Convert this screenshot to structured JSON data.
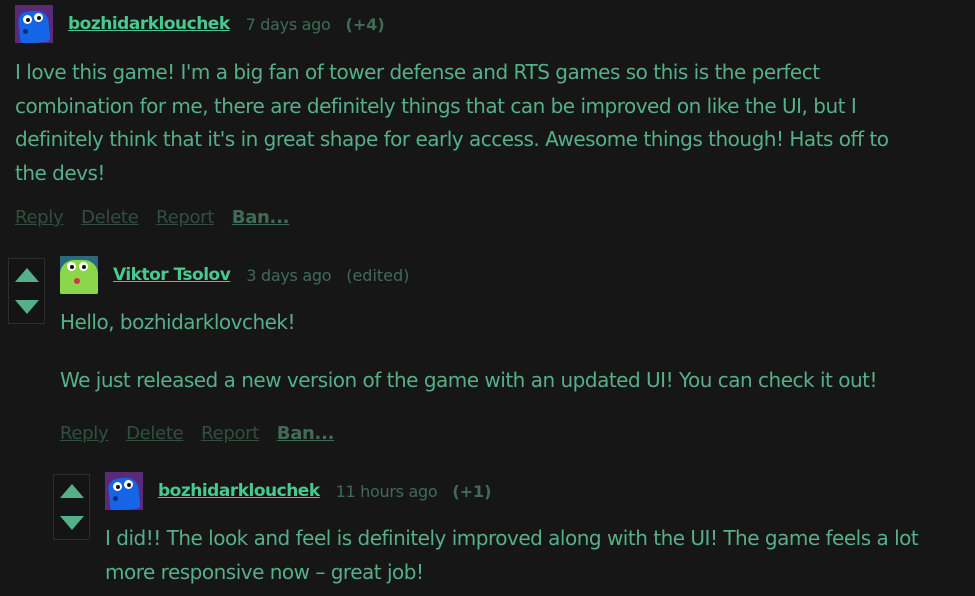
{
  "comments": [
    {
      "username": "bozhidarklouchek",
      "time": "7 days ago",
      "score": "(+4)",
      "text": "I love this game! I'm a big fan of tower defense and RTS games so this is the perfect combination for me, there are definitely things that can be improved on like the UI, but I definitely think that it's in great shape for early access. Awesome things though! Hats off to the devs!",
      "actions": {
        "reply": "Reply",
        "delete": "Delete",
        "report": "Report",
        "ban": "Ban..."
      }
    },
    {
      "username": "Viktor Tsolov",
      "time": "3 days ago",
      "edited": "(edited)",
      "paragraphs": [
        "Hello, bozhidarklovchek!",
        "We just released a new version of the game with an updated UI! You can check it out!"
      ],
      "actions": {
        "reply": "Reply",
        "delete": "Delete",
        "report": "Report",
        "ban": "Ban..."
      }
    },
    {
      "username": "bozhidarklouchek",
      "time": "11 hours ago",
      "score": "(+1)",
      "text": "I did!! The look and feel is definitely improved along with the UI! The game feels a lot more responsive now  – great job!"
    }
  ],
  "icons": {
    "upvote": "upvote-arrow-icon",
    "downvote": "downvote-arrow-icon"
  },
  "colors": {
    "background": "#161616",
    "username": "#48c98f",
    "text": "#55b08a",
    "muted": "#3f6b57"
  }
}
